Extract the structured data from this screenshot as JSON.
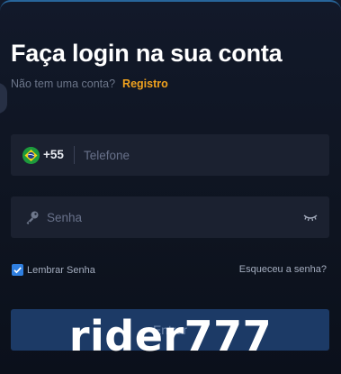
{
  "header": {
    "title": "Faça login na sua conta",
    "no_account_text": "Não tem uma conta?",
    "register_label": "Registro"
  },
  "phone": {
    "country_flag": "brazil-flag-icon",
    "country_code": "+55",
    "placeholder": "Telefone",
    "value": ""
  },
  "password": {
    "placeholder": "Senha",
    "value": "",
    "prefix_icon": "key-icon",
    "toggle_icon": "eye-closed-icon"
  },
  "options": {
    "remember_label": "Lembrar Senha",
    "remember_checked": true,
    "forgot_label": "Esqueceu a senha?"
  },
  "login_button": {
    "label": "Entrar"
  },
  "watermark": {
    "text": "rider777"
  },
  "colors": {
    "accent": "#f0a21e",
    "checkbox": "#2f7fe0",
    "button_bg": "#1c3a66",
    "background": "#0f1522",
    "field_bg": "#1b2130"
  }
}
